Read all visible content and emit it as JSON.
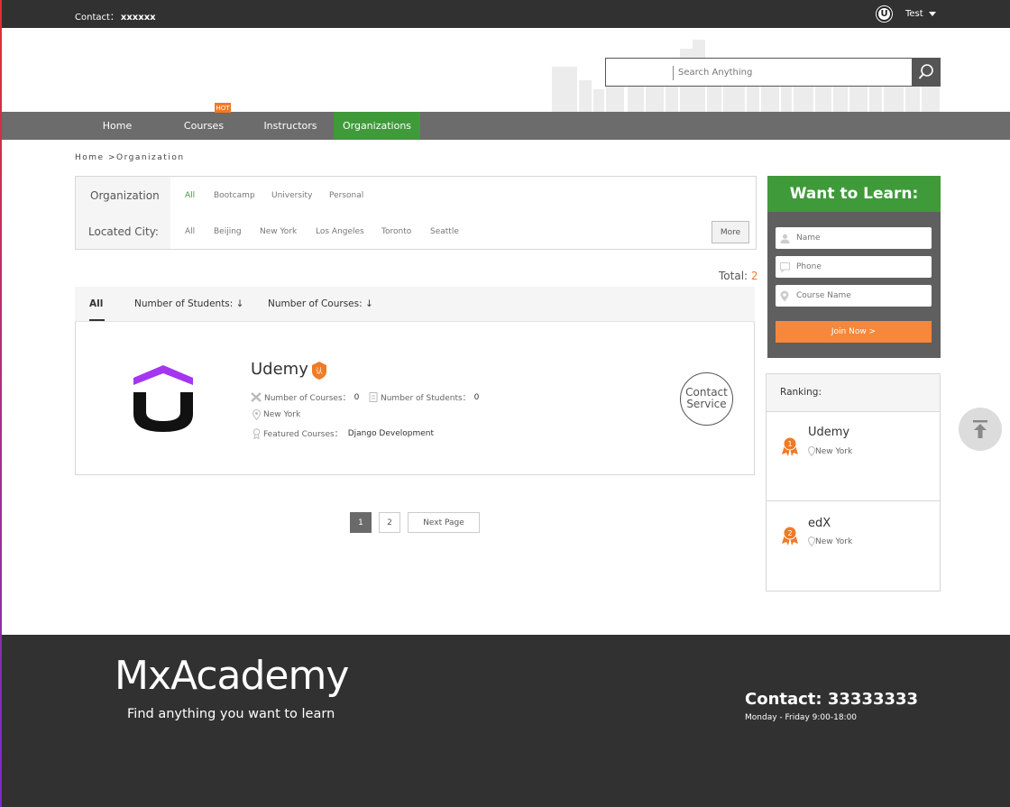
{
  "topbar": {
    "contact_label": "Contact：",
    "contact_value": "xxxxxx",
    "user_name": "Test"
  },
  "search": {
    "placeholder": "Search Anything"
  },
  "nav": {
    "items": [
      {
        "label": "Home"
      },
      {
        "label": "Courses"
      },
      {
        "label": "Instructors"
      },
      {
        "label": "Organizations"
      }
    ],
    "hot_badge": "HOT",
    "active": "Organizations"
  },
  "breadcrumb": {
    "home": "Home",
    "separator": ">",
    "current": "Organization"
  },
  "filter": {
    "org_label": "Organization",
    "org_options": [
      "All",
      "Bootcamp",
      "University",
      "Personal"
    ],
    "city_label": "Located City:",
    "city_options": [
      "All",
      "Beijing",
      "New York",
      "Los Angeles",
      "Toronto",
      "Seattle"
    ],
    "more_label": "More"
  },
  "total": {
    "label": "Total: ",
    "value": "2"
  },
  "sort": {
    "all": "All",
    "students": "Number of Students: ↓",
    "courses": "Number of Courses: ↓"
  },
  "organization": {
    "name": "Udemy",
    "courses_label": "Number of Courses：",
    "courses_value": "0",
    "students_label": "Number of Students：",
    "students_value": "0",
    "city": "New York",
    "featured_label": "Featured Courses：",
    "featured_value": "Django Development",
    "contact_line1": "Contact",
    "contact_line2": "Service"
  },
  "pagination": {
    "pages": [
      "1",
      "2"
    ],
    "current": "1",
    "next_label": "Next Page"
  },
  "want_to_learn": {
    "title": "Want to Learn:",
    "name_placeholder": "Name",
    "phone_placeholder": "Phone",
    "course_placeholder": "Course Name",
    "join_label": "Join Now >"
  },
  "ranking": {
    "title": "Ranking:",
    "items": [
      {
        "rank": "1",
        "name": "Udemy",
        "city": "New York"
      },
      {
        "rank": "2",
        "name": "edX",
        "city": "New York"
      }
    ]
  },
  "footer": {
    "brand": "MxAcademy",
    "tagline": "Find anything you want to learn",
    "contact": "Contact: 33333333",
    "hours": "Monday - Friday 9:00-18:00"
  },
  "colors": {
    "accent_green": "#3f9a3a",
    "accent_orange": "#f7873a",
    "dark": "#313131",
    "nav_gray": "#6c6c6c"
  }
}
